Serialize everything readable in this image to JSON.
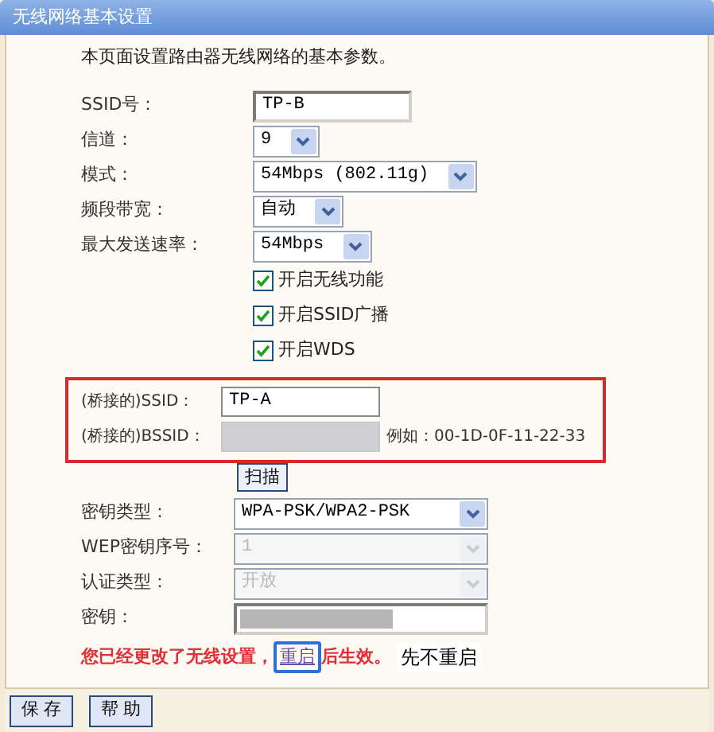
{
  "window": {
    "title": "无线网络基本设置"
  },
  "intro": "本页面设置路由器无线网络的基本参数。",
  "basic_fields": [
    {
      "kind": "text",
      "label": "SSID号：",
      "value": "TP-B"
    },
    {
      "kind": "select",
      "label": "信道：",
      "value": "9",
      "disabled": false
    },
    {
      "kind": "select",
      "label": "模式：",
      "value": "54Mbps (802.11g)",
      "disabled": false
    },
    {
      "kind": "select",
      "label": "频段带宽：",
      "value": "自动",
      "disabled": false
    },
    {
      "kind": "select",
      "label": "最大发送速率：",
      "value": "54Mbps",
      "disabled": false
    }
  ],
  "checkboxes": [
    {
      "label": "开启无线功能",
      "checked": true
    },
    {
      "label": "开启SSID广播",
      "checked": true
    },
    {
      "label": "开启WDS",
      "checked": true
    }
  ],
  "bridge": {
    "ssid_label": "(桥接的)SSID：",
    "ssid_value": "TP-A",
    "bssid_label": "(桥接的)BSSID：",
    "bssid_hint": "例如：00-1D-0F-11-22-33",
    "scan_button": "扫描"
  },
  "security_fields": [
    {
      "kind": "select",
      "label": "密钥类型：",
      "value": "WPA-PSK/WPA2-PSK",
      "disabled": false
    },
    {
      "kind": "select",
      "label": "WEP密钥序号：",
      "value": "1",
      "disabled": true
    },
    {
      "kind": "select",
      "label": "认证类型：",
      "value": "开放",
      "disabled": true
    },
    {
      "kind": "masked",
      "label": "密钥："
    }
  ],
  "notice": {
    "before": "您已经更改了无线设置，",
    "link": "重启",
    "after": "后生效。",
    "annotation": "先不重启"
  },
  "buttons": [
    "保 存",
    "帮 助"
  ]
}
